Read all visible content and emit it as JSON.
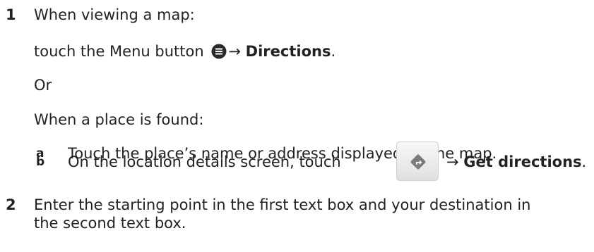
{
  "step1": {
    "number": "1",
    "line1": "When viewing a map:",
    "line2_prefix": "touch the Menu button",
    "line2_arrow": "→",
    "line2_bold": "Directions",
    "line2_suffix": ".",
    "or": "Or",
    "line4": "When a place is found:",
    "sub_a": {
      "letter": "a",
      "text": "Touch the place’s name or address displayed on the map."
    },
    "sub_b": {
      "letter": "b",
      "text": "On the location details screen, touch",
      "arrow": "→",
      "bold": "Get directions",
      "suffix": "."
    }
  },
  "step2": {
    "number": "2",
    "line1": "Enter the starting point in the first text box and your destination in",
    "line2": "the second text box."
  },
  "icons": {
    "menu": "menu-icon",
    "directions": "directions-icon"
  }
}
